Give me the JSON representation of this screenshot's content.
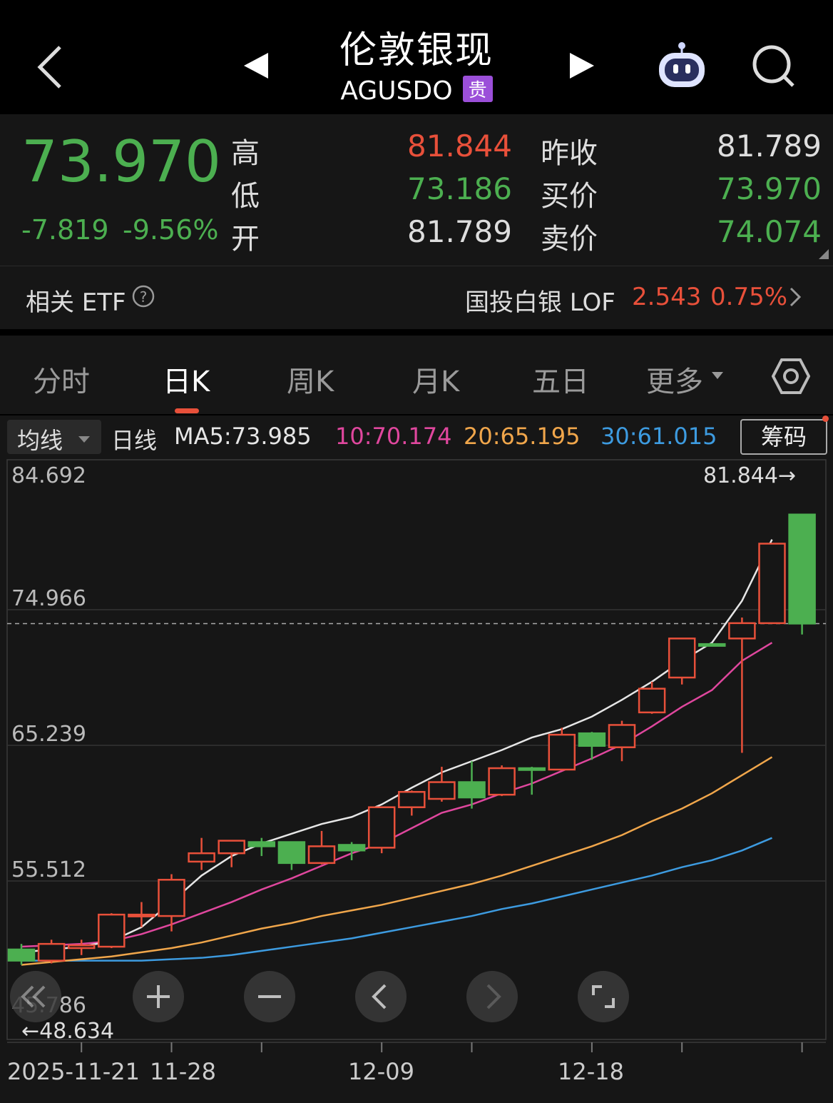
{
  "header": {
    "title": "伦敦银现",
    "code": "AGUSDO",
    "tag": "贵"
  },
  "quote": {
    "price": "73.970",
    "change": "-7.819",
    "change_pct": "-9.56%",
    "high_label": "高",
    "high": "81.844",
    "low_label": "低",
    "low": "73.186",
    "open_label": "开",
    "open": "81.789",
    "prev_close_label": "昨收",
    "prev_close": "81.789",
    "bid_label": "买价",
    "bid": "73.970",
    "ask_label": "卖价",
    "ask": "74.074"
  },
  "etf": {
    "label": "相关 ETF",
    "name": "国投白银 LOF",
    "price": "2.543",
    "pct": "0.75%"
  },
  "tabs": [
    "分时",
    "日K",
    "周K",
    "月K",
    "五日",
    "更多"
  ],
  "active_tab": 1,
  "ma": {
    "selector": "均线",
    "period": "日线",
    "ma5": "MA5:73.985",
    "ma10": "10:70.174",
    "ma20": "20:65.195",
    "ma30": "30:61.015",
    "chip_button": "筹码"
  },
  "colors": {
    "up": "#e8503a",
    "down": "#4caf50",
    "ma5": "#e6e6e6",
    "ma10": "#e0479e",
    "ma20": "#f0a64b",
    "ma30": "#3d9be0"
  },
  "chart_data": {
    "type": "candlestick",
    "y_ticks": [
      "84.692",
      "74.966",
      "65.239",
      "55.512",
      "45.786"
    ],
    "ylim": [
      45.786,
      84.692
    ],
    "x_ticks": [
      "2025-11-21",
      "11-28",
      "12-09",
      "12-18"
    ],
    "high_marker": "81.844→",
    "low_marker": "←48.634",
    "current_price_line": 73.97,
    "candles": [
      {
        "o": 50.6,
        "c": 49.8,
        "h": 51.0,
        "l": 49.5
      },
      {
        "o": 49.8,
        "c": 51.0,
        "h": 51.3,
        "l": 49.6
      },
      {
        "o": 50.7,
        "c": 50.9,
        "h": 51.3,
        "l": 50.2
      },
      {
        "o": 50.8,
        "c": 53.1,
        "h": 53.2,
        "l": 50.7
      },
      {
        "o": 53.0,
        "c": 53.1,
        "h": 54.0,
        "l": 52.2
      },
      {
        "o": 53.0,
        "c": 55.6,
        "h": 56.0,
        "l": 51.9
      },
      {
        "o": 56.9,
        "c": 57.5,
        "h": 58.6,
        "l": 56.3
      },
      {
        "o": 57.5,
        "c": 58.4,
        "h": 58.4,
        "l": 56.5
      },
      {
        "o": 58.3,
        "c": 58.0,
        "h": 58.6,
        "l": 57.3
      },
      {
        "o": 58.3,
        "c": 56.8,
        "h": 58.3,
        "l": 56.3
      },
      {
        "o": 56.8,
        "c": 58.0,
        "h": 59.1,
        "l": 56.7
      },
      {
        "o": 58.1,
        "c": 57.7,
        "h": 58.3,
        "l": 57.0
      },
      {
        "o": 57.9,
        "c": 60.8,
        "h": 60.8,
        "l": 57.5
      },
      {
        "o": 60.8,
        "c": 61.9,
        "h": 62.0,
        "l": 60.2
      },
      {
        "o": 61.4,
        "c": 62.6,
        "h": 63.7,
        "l": 61.2
      },
      {
        "o": 62.6,
        "c": 61.5,
        "h": 64.1,
        "l": 60.7
      },
      {
        "o": 61.7,
        "c": 63.6,
        "h": 63.8,
        "l": 61.6
      },
      {
        "o": 63.6,
        "c": 63.5,
        "h": 63.7,
        "l": 61.7
      },
      {
        "o": 63.5,
        "c": 66.0,
        "h": 66.5,
        "l": 63.5
      },
      {
        "o": 66.1,
        "c": 65.2,
        "h": 66.2,
        "l": 64.2
      },
      {
        "o": 65.1,
        "c": 66.7,
        "h": 67.0,
        "l": 64.1
      },
      {
        "o": 67.6,
        "c": 69.3,
        "h": 69.8,
        "l": 67.5
      },
      {
        "o": 70.1,
        "c": 72.9,
        "h": 72.9,
        "l": 69.6
      },
      {
        "o": 72.5,
        "c": 72.4,
        "h": 72.5,
        "l": 72.4
      },
      {
        "o": 72.9,
        "c": 74.0,
        "h": 74.4,
        "l": 64.7
      },
      {
        "o": 74.0,
        "c": 79.7,
        "h": 79.7,
        "l": 74.0
      },
      {
        "o": 81.789,
        "c": 73.97,
        "h": 81.844,
        "l": 73.186
      }
    ],
    "ma5": [
      50.4,
      50.6,
      50.8,
      51.2,
      52.2,
      54.0,
      55.9,
      57.3,
      58.2,
      58.9,
      59.6,
      60.1,
      61.0,
      62.2,
      63.3,
      64.1,
      64.9,
      65.8,
      66.4,
      67.3,
      68.5,
      69.8,
      71.3,
      72.6,
      75.6,
      80.0
    ],
    "ma10": [
      50.8,
      50.9,
      51.0,
      51.2,
      51.7,
      52.4,
      53.2,
      54.0,
      54.9,
      55.7,
      56.6,
      57.5,
      58.2,
      59.3,
      60.4,
      61.0,
      61.8,
      62.5,
      63.4,
      64.3,
      65.3,
      66.6,
      68.0,
      69.2,
      71.3,
      72.6
    ],
    "ma20": [
      49.5,
      49.7,
      49.9,
      50.1,
      50.4,
      50.7,
      51.1,
      51.6,
      52.1,
      52.5,
      53.0,
      53.4,
      53.8,
      54.3,
      54.8,
      55.3,
      55.9,
      56.6,
      57.3,
      58.0,
      58.8,
      59.8,
      60.7,
      61.8,
      63.1,
      64.4
    ],
    "ma30": [
      49.8,
      49.8,
      49.8,
      49.8,
      49.8,
      49.9,
      50.0,
      50.2,
      50.5,
      50.8,
      51.1,
      51.4,
      51.8,
      52.2,
      52.6,
      53.0,
      53.5,
      53.9,
      54.4,
      54.9,
      55.4,
      55.9,
      56.5,
      57.0,
      57.7,
      58.6
    ]
  }
}
